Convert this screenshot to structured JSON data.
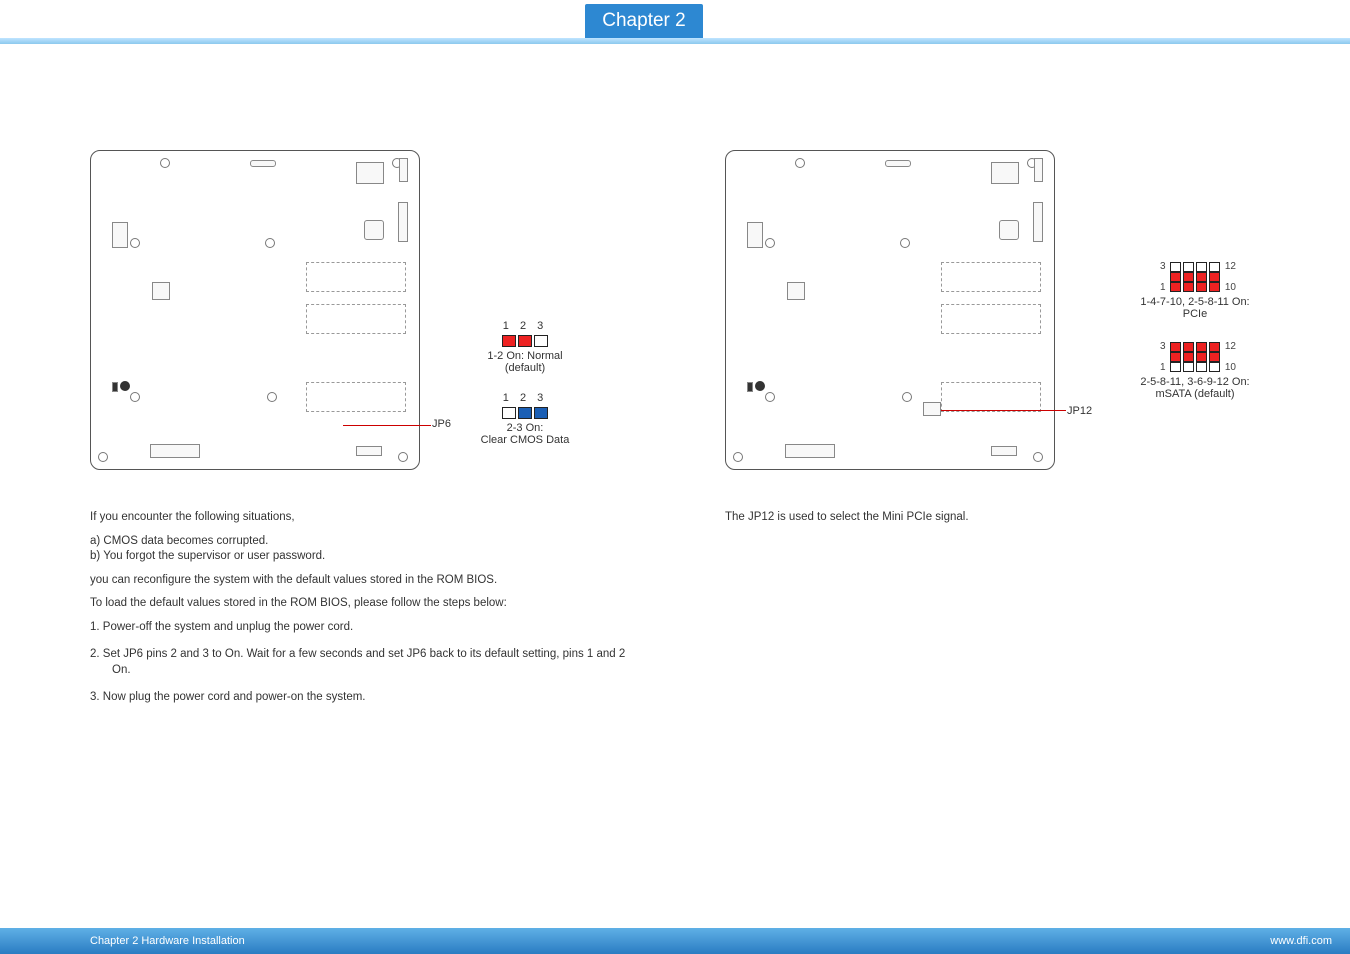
{
  "tab": {
    "label": "Chapter 2"
  },
  "footer": {
    "left": "Chapter 2 Hardware Installation",
    "right": "www.dfi.com"
  },
  "left": {
    "jp6_label": "JP6",
    "jumper_a": {
      "pins": "1  2  3",
      "caption1": "1-2 On: Normal",
      "caption2": "(default)"
    },
    "jumper_b": {
      "pins": "1  2  3",
      "caption1": "2-3 On:",
      "caption2": "Clear CMOS Data"
    },
    "text": {
      "intro": "If you encounter the following situations,",
      "a": "a)  CMOS data becomes corrupted.",
      "b": "b)  You forgot the supervisor or user password.",
      "reconfigure": "you can reconfigure the system with the default values stored in the ROM BIOS.",
      "toload": "To load the default values stored in the ROM BIOS, please follow the steps below:",
      "s1": "1.   Power-off the system and unplug the power cord.",
      "s2": "2.   Set JP6 pins 2 and 3 to On. Wait for a few seconds and set JP6 back to its default setting, pins 1 and 2 On.",
      "s3": "3.   Now plug the power cord and power-on the system."
    }
  },
  "right": {
    "jp12_label": "JP12",
    "block_a": {
      "pin_tl": "3",
      "pin_tr": "12",
      "pin_bl": "1",
      "pin_br": "10",
      "caption1": "1-4-7-10, 2-5-8-11 On:",
      "caption2": "PCIe"
    },
    "block_b": {
      "pin_tl": "3",
      "pin_tr": "12",
      "pin_bl": "1",
      "pin_br": "10",
      "caption1": "2-5-8-11, 3-6-9-12  On:",
      "caption2": "mSATA (default)"
    },
    "text": {
      "desc": "The JP12 is used to select the Mini PCIe signal."
    }
  }
}
